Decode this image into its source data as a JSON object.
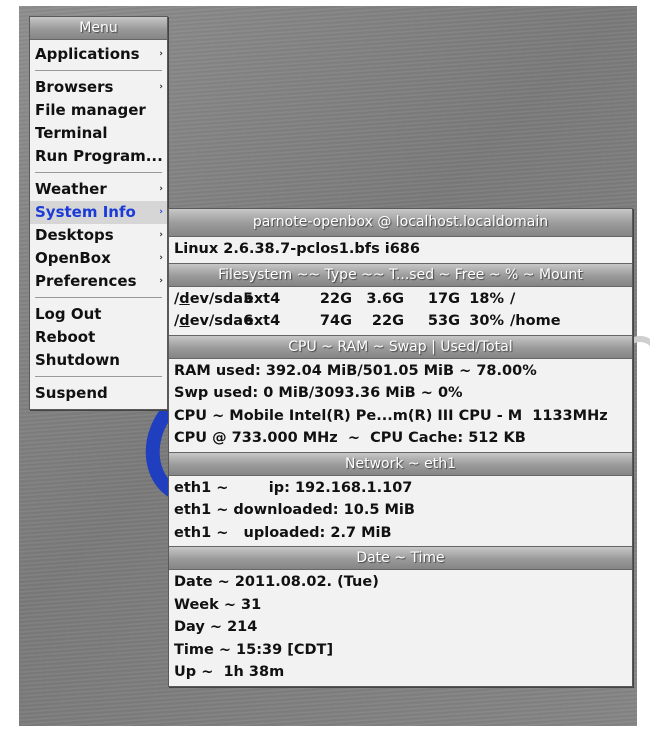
{
  "main_menu": {
    "title": "Menu",
    "items": [
      {
        "label": "Applications",
        "submenu": true
      },
      {
        "label": "Browsers",
        "submenu": true
      },
      {
        "label": "File manager",
        "submenu": false
      },
      {
        "label": "Terminal",
        "submenu": false
      },
      {
        "label": "Run Program...",
        "submenu": false
      },
      {
        "label": "Weather",
        "submenu": true
      },
      {
        "label": "System Info",
        "submenu": true,
        "active": true
      },
      {
        "label": "Desktops",
        "submenu": true
      },
      {
        "label": "OpenBox",
        "submenu": true
      },
      {
        "label": "Preferences",
        "submenu": true
      },
      {
        "label": "Log Out",
        "submenu": false
      },
      {
        "label": "Reboot",
        "submenu": false
      },
      {
        "label": "Shutdown",
        "submenu": false
      },
      {
        "label": "Suspend",
        "submenu": false
      }
    ],
    "submenu_arrow": "›"
  },
  "sysinfo": {
    "title": "parnote-openbox @ localhost.localdomain",
    "kernel": "Linux 2.6.38.7-pclos1.bfs i686",
    "fs_header": "Filesystem ~~ Type ~~ T...sed ~ Free ~ % ~ Mount",
    "filesystems": [
      {
        "dev_prefix": "/",
        "dev_ul": "d",
        "dev_rest": "ev/sda5",
        "type": "ext4",
        "size": "22G",
        "used": "3.6G",
        "free": "17G",
        "pct": "18%",
        "mount": "/"
      },
      {
        "dev_prefix": "/",
        "dev_ul": "d",
        "dev_rest": "ev/sda6",
        "type": "ext4",
        "size": "74G",
        "used": "22G",
        "free": "53G",
        "pct": "30%",
        "mount": "/home"
      }
    ],
    "cpu_header": "CPU ~ RAM ~ Swap | Used/Total",
    "cpu_rows": [
      "RAM used: 392.04 MiB/501.05 MiB ~ 78.00%",
      "Swp used: 0 MiB/3093.36 MiB ~ 0%",
      "CPU ~ Mobile Intel(R) Pe...m(R) III CPU - M  1133MHz",
      "CPU @ 733.000 MHz  ~  CPU Cache: 512 KB"
    ],
    "net_header": "Network ~ eth1",
    "net_rows": [
      "eth1 ~        ip: 192.168.1.107",
      "eth1 ~ downloaded: 10.5 MiB",
      "eth1 ~   uploaded: 2.7 MiB"
    ],
    "date_header": "Date ~ Time",
    "date_rows": [
      "Date ~ 2011.08.02. (Tue)",
      "Week ~ 31",
      "Day ~ 214",
      "Time ~ 15:39 [CDT]",
      "Up ~  1h 38m"
    ]
  },
  "colors": {
    "active_text": "#1a3bd8",
    "menu_bg": "#f2f2f2",
    "title_gradient_top": "#c7c7c7",
    "title_gradient_bottom": "#858585"
  }
}
